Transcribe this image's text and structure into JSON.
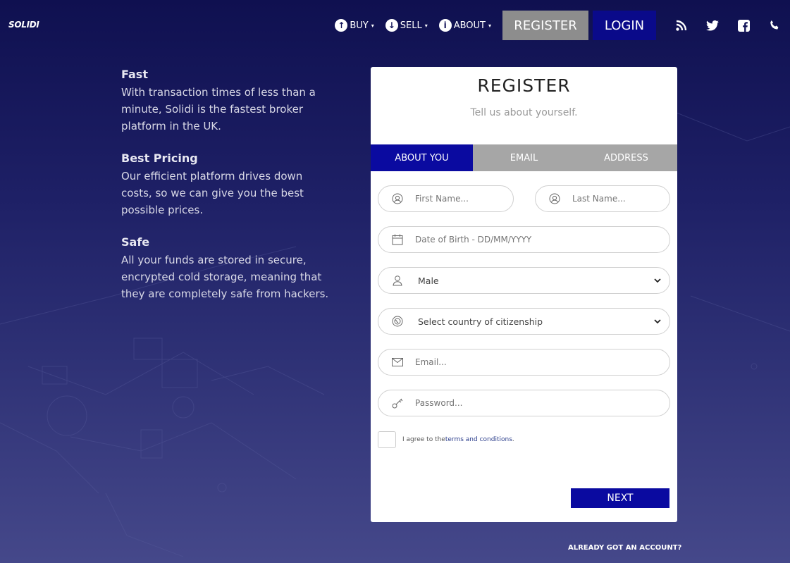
{
  "header": {
    "logo": "SOLIDI",
    "nav": [
      {
        "label": "BUY",
        "icon": "arrow-up-circle-icon"
      },
      {
        "label": "SELL",
        "icon": "arrow-down-circle-icon"
      },
      {
        "label": "ABOUT",
        "icon": "info-circle-icon"
      }
    ],
    "register_label": "REGISTER",
    "login_label": "LOGIN",
    "social": [
      "rss-icon",
      "twitter-icon",
      "facebook-icon",
      "phone-icon"
    ]
  },
  "features": [
    {
      "title": "Fast",
      "text": "With transaction times of less than a minute, Solidi is the fastest broker platform in the UK."
    },
    {
      "title": "Best Pricing",
      "text": "Our efficient platform drives down costs, so we can give you the best possible prices."
    },
    {
      "title": "Safe",
      "text": "All your funds are stored in secure, encrypted cold storage, meaning that they are completely safe from hackers."
    }
  ],
  "card": {
    "title": "REGISTER",
    "subtitle": "Tell us about yourself.",
    "tabs": [
      "ABOUT YOU",
      "EMAIL",
      "ADDRESS"
    ],
    "active_tab": 0,
    "fields": {
      "first_name_placeholder": "First Name...",
      "last_name_placeholder": "Last Name...",
      "dob_placeholder": "Date of Birth - DD/MM/YYYY",
      "gender_value": "Male",
      "country_value": "Select country of citizenship",
      "email_placeholder": "Email...",
      "password_placeholder": "Password..."
    },
    "agree_text": "I agree to the ",
    "agree_link": "terms and conditions",
    "agree_end": ".",
    "next_label": "NEXT"
  },
  "already_account": "ALREADY GOT AN ACCOUNT?",
  "colors": {
    "accent": "#0a0aa0",
    "inactive_tab": "#a6a6a6",
    "register_btn": "#8d8d8d"
  }
}
